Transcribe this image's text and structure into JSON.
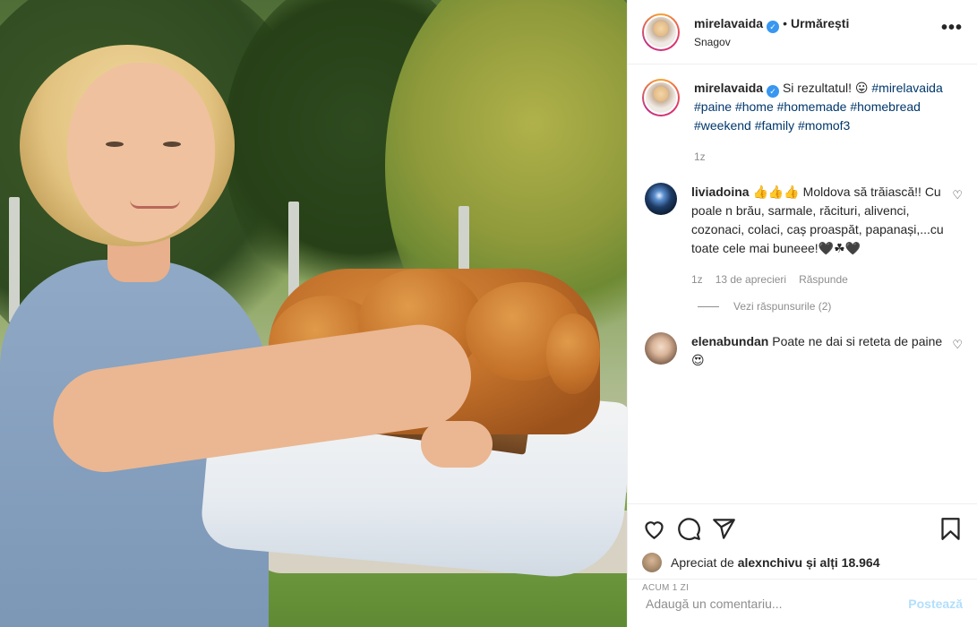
{
  "post": {
    "username": "mirelavaida",
    "verified": true,
    "follow_label": "Urmărești",
    "location": "Snagov",
    "more_label": "•••"
  },
  "caption": {
    "username": "mirelavaida",
    "text": "Si rezultatul! 😛",
    "tags": [
      "#mirelavaida",
      "#paine",
      "#home",
      "#homemade",
      "#homebread",
      "#weekend",
      "#family",
      "#momof3"
    ],
    "time": "1z"
  },
  "comments": [
    {
      "username": "liviadoina",
      "text": "👍👍👍 Moldova să trăiască!! Cu poale n brău, sarmale, răcituri, alivenci, cozonaci, colaci, caș proaspăt, papanași,...cu toate cele mai buneee!🖤☘🖤",
      "time": "1z",
      "likes": "13 de aprecieri",
      "reply_label": "Răspunde",
      "view_replies": "Vezi răspunsurile (2)"
    },
    {
      "username": "elenabundan",
      "text": "Poate ne dai si reteta de paine😍"
    }
  ],
  "actions": {
    "like_icon": "heart-icon",
    "comment_icon": "comment-icon",
    "share_icon": "share-icon",
    "save_icon": "bookmark-icon"
  },
  "likes": {
    "prefix": "Apreciat de",
    "user": "alexnchivu",
    "suffix": "și alți",
    "count": "18.964"
  },
  "timestamp": "ACUM 1 ZI",
  "add_comment": {
    "placeholder": "Adaugă un comentariu...",
    "post_label": "Postează"
  },
  "colors": {
    "link": "#00376b",
    "verified": "#3897f0",
    "muted": "#8e8e8e",
    "post_disabled": "#b2dffc"
  }
}
